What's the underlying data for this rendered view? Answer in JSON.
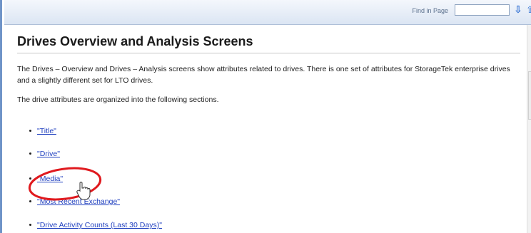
{
  "find_bar": {
    "label": "Find in Page",
    "input_value": "",
    "next_icon": "arrow-down-icon",
    "prev_icon": "arrow-up-icon"
  },
  "page": {
    "title": "Drives Overview and Analysis Screens",
    "intro": "The Drives – Overview and Drives – Analysis screens show attributes related to drives. There is one set of attributes for StorageTek enterprise drives and a slightly different set for LTO drives.",
    "sections_intro": "The drive attributes are organized into the following sections.",
    "links": [
      {
        "label": "\"Title\""
      },
      {
        "label": "\"Drive\""
      },
      {
        "label": "\"Media\""
      },
      {
        "label": "\"Most Recent Exchange\""
      },
      {
        "label": "\"Drive Activity Counts (Last 30 Days)\""
      }
    ]
  },
  "annotation": {
    "shape": "red-ellipse-highlight",
    "color": "#e0191e",
    "cursor_icon": "hand-pointer-icon"
  }
}
